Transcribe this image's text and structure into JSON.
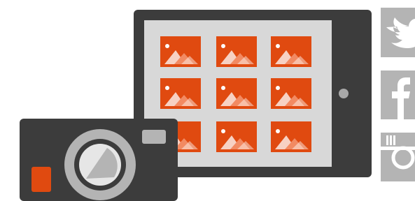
{
  "colors": {
    "background": "#ffffff",
    "device_dark": "#3c3c3c",
    "screen": "#d8d8d8",
    "photo_orange": "#e04a10",
    "photo_light": "#f28a62",
    "icon_gray": "#b4b4b4",
    "camera_accent": "#e04a10"
  },
  "gallery": {
    "thumbnails": [
      {
        "icon": "image-icon"
      },
      {
        "icon": "image-icon"
      },
      {
        "icon": "image-icon"
      },
      {
        "icon": "image-icon"
      },
      {
        "icon": "image-icon"
      },
      {
        "icon": "image-icon"
      },
      {
        "icon": "image-icon"
      },
      {
        "icon": "image-icon"
      },
      {
        "icon": "image-icon"
      }
    ]
  },
  "social_icons": [
    {
      "icon": "twitter-icon"
    },
    {
      "icon": "facebook-icon"
    },
    {
      "icon": "instagram-icon"
    }
  ],
  "camera": {
    "icon": "camera-icon"
  }
}
